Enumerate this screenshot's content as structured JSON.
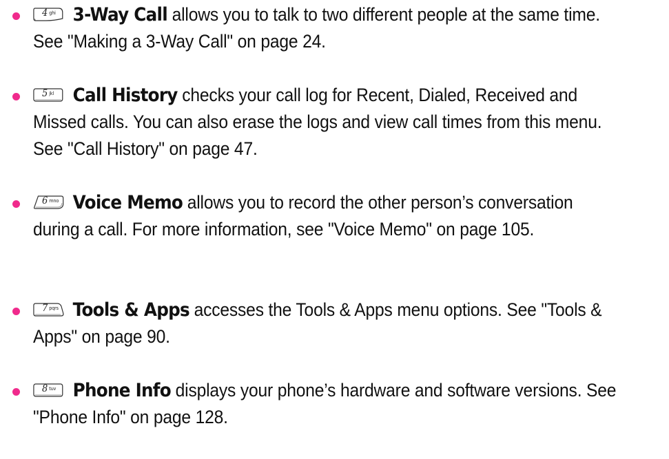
{
  "items": [
    {
      "key_digit": "4",
      "key_letters": "ghi",
      "title": "3-Way Call",
      "body": " allows you to talk to two different people at the same time. See \"Making a 3-Way Call\" on page 24."
    },
    {
      "key_digit": "5",
      "key_letters": "jkl",
      "title": "Call History",
      "body": " checks your call log for Recent, Dialed, Received and Missed calls. You can also erase the logs and view call times from this menu. See \"Call History\" on page 47."
    },
    {
      "key_digit": "6",
      "key_letters": "mno",
      "title": "Voice Memo",
      "body": " allows you to record the other person’s conversation during a call. For more information, see \"Voice Memo\" on page 105."
    },
    {
      "key_digit": "7",
      "key_letters": "pqrs",
      "title": "Tools & Apps",
      "body": " accesses the Tools & Apps menu options. See \"Tools & Apps\" on page 90."
    },
    {
      "key_digit": "8",
      "key_letters": "tuv",
      "title": "Phone Info",
      "body": " displays your phone’s hardware and software versions. See \"Phone Info\" on page 128."
    }
  ],
  "colors": {
    "bullet": "#f02a8c",
    "text": "#111111"
  },
  "icons": {
    "bullet": "bullet-icon",
    "key": "phone-keypad-key-icon"
  }
}
